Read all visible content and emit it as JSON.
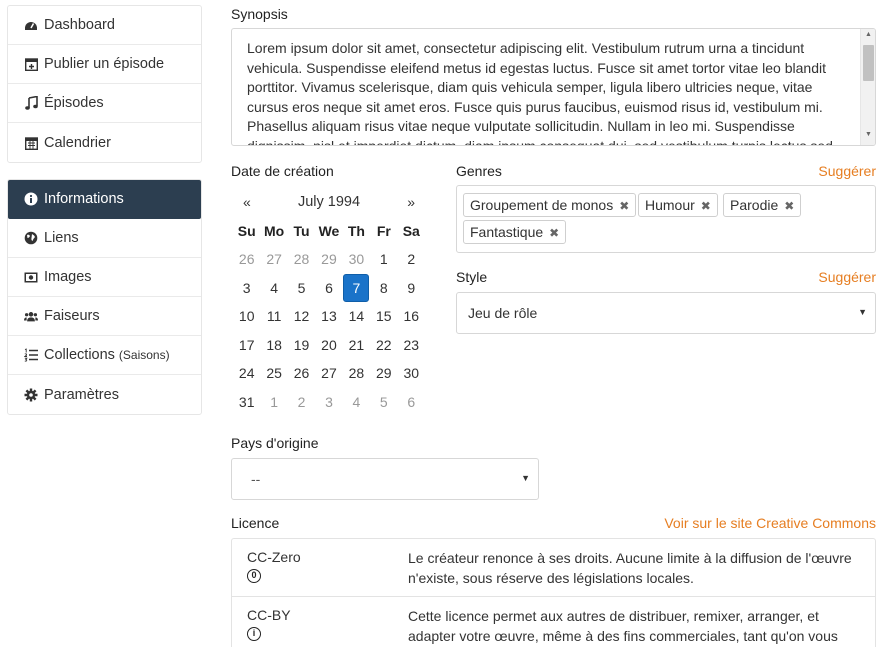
{
  "sidebar": {
    "top_items": [
      {
        "label": "Dashboard"
      },
      {
        "label": "Publier un épisode"
      },
      {
        "label": "Épisodes"
      },
      {
        "label": "Calendrier"
      }
    ],
    "bottom_items": [
      {
        "label": "Informations"
      },
      {
        "label": "Liens"
      },
      {
        "label": "Images"
      },
      {
        "label": "Faiseurs"
      },
      {
        "label": "Collections",
        "suffix": "(Saisons)"
      },
      {
        "label": "Paramètres"
      }
    ]
  },
  "synopsis": {
    "label": "Synopsis",
    "text": "Lorem ipsum dolor sit amet, consectetur adipiscing elit. Vestibulum rutrum urna a tincidunt vehicula. Suspendisse eleifend metus id egestas luctus. Fusce sit amet tortor vitae leo blandit porttitor. Vivamus scelerisque, diam quis vehicula semper, ligula libero ultricies neque, vitae cursus eros neque sit amet eros. Fusce quis purus faucibus, euismod risus id, vestibulum mi. Phasellus aliquam risus vitae neque vulputate sollicitudin. Nullam in leo mi. Suspendisse dignissim, nisl et imperdiet dictum, diam ipsum consequat dui, sed vestibulum turpis lectus sed"
  },
  "date": {
    "label": "Date de création",
    "prev": "«",
    "next": "»",
    "month": "July 1994",
    "weekdays": [
      "Su",
      "Mo",
      "Tu",
      "We",
      "Th",
      "Fr",
      "Sa"
    ],
    "weeks": [
      [
        "26",
        "27",
        "28",
        "29",
        "30",
        "1",
        "2"
      ],
      [
        "3",
        "4",
        "5",
        "6",
        "7",
        "8",
        "9"
      ],
      [
        "10",
        "11",
        "12",
        "13",
        "14",
        "15",
        "16"
      ],
      [
        "17",
        "18",
        "19",
        "20",
        "21",
        "22",
        "23"
      ],
      [
        "24",
        "25",
        "26",
        "27",
        "28",
        "29",
        "30"
      ],
      [
        "31",
        "1",
        "2",
        "3",
        "4",
        "5",
        "6"
      ]
    ],
    "selected": "7"
  },
  "genres": {
    "label": "Genres",
    "suggest": "Suggérer",
    "tags": [
      "Groupement de monos",
      "Humour",
      "Parodie",
      "Fantastique"
    ],
    "remove_glyph": "✖"
  },
  "style": {
    "label": "Style",
    "suggest": "Suggérer",
    "value": "Jeu de rôle"
  },
  "pays": {
    "label": "Pays d'origine",
    "value": "--"
  },
  "licence": {
    "label": "Licence",
    "link": "Voir sur le site Creative Commons",
    "items": [
      {
        "name": "CC-Zero",
        "icon": "0",
        "desc": "Le créateur renonce à ses droits. Aucune limite à la diffusion de l'œuvre n'existe, sous réserve des législations locales."
      },
      {
        "name": "CC-BY",
        "icon": "i",
        "desc": "Cette licence permet aux autres de distribuer, remixer, arranger, et adapter votre œuvre, même à des fins commerciales, tant qu'on vous"
      }
    ]
  }
}
